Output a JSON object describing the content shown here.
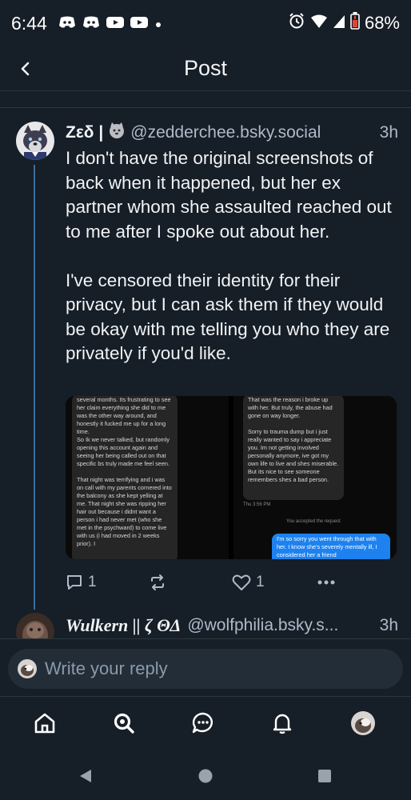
{
  "status_bar": {
    "time": "6:44",
    "battery": "68%"
  },
  "header": {
    "title": "Post"
  },
  "post": {
    "display_name": "Zεδ |",
    "handle": "@zedderchee.bsky.social",
    "time": "3h",
    "paragraphs": [
      "I don't have the original screenshots of back when it happened, but her ex partner whom she assaulted reached out to me after I spoke out about her.",
      "I've censored their identity for their privacy, but I can ask them if they would be okay with me telling you who they are privately if you'd like."
    ],
    "images": {
      "left_messages": [
        "several months. Its frustrating to see her claim everything she did to me was the other way around, and honestly it fucked me up for a long time.",
        "So Ik we never talked, but randomly opening this account again and seeing her being called out on that specific bs truly made me feel seen.",
        "That night was terrifying and i was on call with my parents cornered into the balcony as she kept yelling at me. That night she was ripping her hair out because i didnt want a person i had never met (who she met in the psychward) to come live with us (i had moved in 2 weeks prior). I"
      ],
      "right_messages": [
        "That was the reason i broke up with her. But truly, the abuse had gone on way longer.",
        "Sorry to trauma dump but i just really wanted to say i appreciate you. Im not getting involved personally anymore, ive got my own life to live and shes miserable. But its nice to see someone remembers shes a bad person."
      ],
      "timestamp": "Thu 3:56 PM",
      "accepted": "You accepted the request",
      "sent_message": "I'm so sorry you went through that with her. I know she's severely mentally ill, I considered her a friend"
    },
    "reply_count": "1",
    "like_count": "1"
  },
  "reply": {
    "display_name": "Wulkern || ζ ΘΔ",
    "handle": "@wolfphilia.bsky.s...",
    "time": "3h"
  },
  "composer": {
    "placeholder": "Write your reply"
  },
  "colors": {
    "background": "#161e27",
    "thread_line": "#3c6f9d",
    "secondary_text": "#aebbc9",
    "sent_bubble": "#1d82f0"
  }
}
